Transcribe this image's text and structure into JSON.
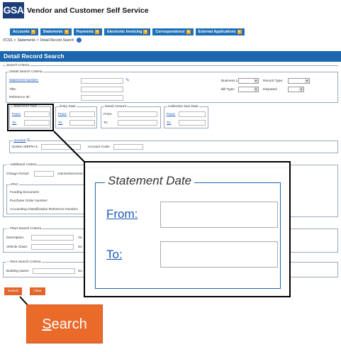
{
  "header": {
    "logo": "GSA",
    "title": "Vendor and Customer Self Service"
  },
  "nav": [
    {
      "label": "Accounts"
    },
    {
      "label": "Statements"
    },
    {
      "label": "Payments"
    },
    {
      "label": "Electronic Invoicing"
    },
    {
      "label": "Correspondence"
    },
    {
      "label": "External Applications"
    }
  ],
  "breadcrumbs": [
    "VCSS",
    ">",
    "Statements",
    ">",
    "Detail Record Search"
  ],
  "page_title": "Detail Record Search",
  "search_criteria": {
    "legend": "Search Criteria",
    "detail": {
      "legend": "Detail Search Criteria",
      "statement_number": "Statement Number:",
      "title": "Title:",
      "reference_id": "Reference ID:",
      "business_line": "Business Line:",
      "record_type": "Record Type:",
      "bill_type": "Bill Type:",
      "disputed": "Disputed:"
    },
    "statement_date": {
      "legend": "Statement Date",
      "from": "From:",
      "to": "To:"
    },
    "entry_date": {
      "legend": "Entry Date",
      "from": "From:",
      "to": "To:"
    },
    "detail_amount": {
      "legend": "Detail Amount",
      "from": "From:",
      "to": "To:"
    },
    "collection_due_date": {
      "legend": "Collection Due Date",
      "from": "From:",
      "to": "To:"
    },
    "account": {
      "legend": "Account",
      "duns": "DUNS+4/BPN+4:",
      "account_code": "Account Code:"
    }
  },
  "additional": {
    "legend": "Additional Criteria",
    "charge_period": "Charge Period:",
    "articles_services": "Articles/Services:",
    "ipac": "IPAC",
    "funding_document": "Funding Document:",
    "purchase_order": "Purchase Order Number:",
    "accounting_ref": "Accounting Classification Reference Number:"
  },
  "fleet": {
    "legend": "Fleet Search Criteria",
    "description": "Description:",
    "vehicle_class": "Vehicle Class:",
    "ve": "Ve",
    "se": "Se"
  },
  "rent": {
    "legend": "Rent Search Criteria",
    "building_name": "Building Name:",
    "so": "So"
  },
  "buttons": {
    "search": "Search",
    "clear": "Clear"
  },
  "zoom_statement": {
    "legend": "Statement Date",
    "from": "From:",
    "to": "To:"
  },
  "zoom_search": {
    "first": "S",
    "rest": "earch"
  },
  "colors": {
    "accent": "#1b66ad",
    "button": "#e4652a"
  }
}
